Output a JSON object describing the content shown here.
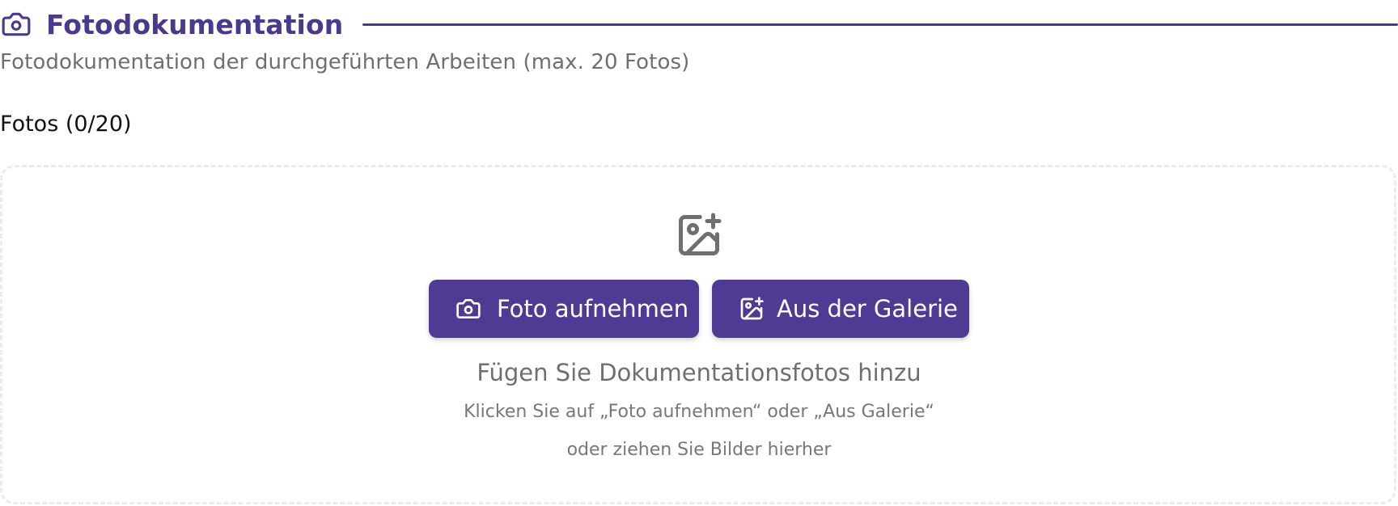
{
  "section": {
    "title": "Fotodokumentation",
    "icon": "camera-icon",
    "description": "Fotodokumentation der durchgeführten Arbeiten (max. 20 Fotos)"
  },
  "photos": {
    "label": "Fotos (0/20)",
    "current": 0,
    "max": 20
  },
  "dropzone": {
    "icon": "image-plus-icon",
    "camera_button": {
      "icon": "camera-icon",
      "label": "Foto aufnehmen"
    },
    "gallery_button": {
      "icon": "image-plus-icon",
      "label": "Aus der Galerie"
    },
    "title": "Fügen Sie Dokumentationsfotos hinzu",
    "hint_line_1": "Klicken Sie auf „Foto aufnehmen“ oder „Aus Galerie“",
    "hint_line_2": "oder ziehen Sie Bilder hierher"
  },
  "colors": {
    "accent": "#4f3b94",
    "title": "#4a3a8e",
    "muted_text": "#6f6f6f",
    "dropzone_border": "#ececec"
  }
}
